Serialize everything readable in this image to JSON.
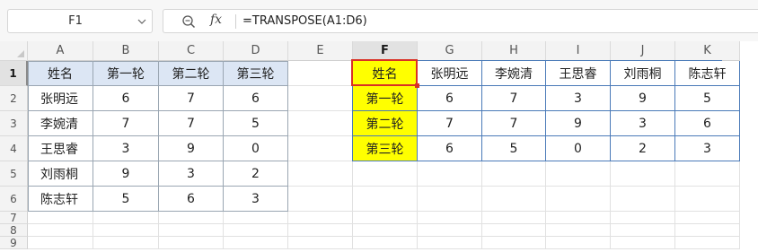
{
  "formula_bar": {
    "name_box": "F1",
    "formula": "=TRANSPOSE(A1:D6)",
    "fx_label": "fx"
  },
  "columns": [
    "A",
    "B",
    "C",
    "D",
    "E",
    "F",
    "G",
    "H",
    "I",
    "J",
    "K"
  ],
  "rows": [
    "1",
    "2",
    "3",
    "4",
    "5",
    "6",
    "7",
    "8",
    "9"
  ],
  "selected": {
    "column": "F",
    "row": "1"
  },
  "colors": {
    "header_blue": "#dce6f4",
    "yellow": "#ffff00",
    "active_border": "#d93025",
    "range_border": "#4a7ab8"
  },
  "cells": {
    "A1": "姓名",
    "B1": "第一轮",
    "C1": "第二轮",
    "D1": "第三轮",
    "A2": "张明远",
    "B2": "6",
    "C2": "7",
    "D2": "6",
    "A3": "李婉清",
    "B3": "7",
    "C3": "7",
    "D3": "5",
    "A4": "王思睿",
    "B4": "3",
    "C4": "9",
    "D4": "0",
    "A5": "刘雨桐",
    "B5": "9",
    "C5": "3",
    "D5": "2",
    "A6": "陈志轩",
    "B6": "5",
    "C6": "6",
    "D6": "3",
    "F1": "姓名",
    "G1": "张明远",
    "H1": "李婉清",
    "I1": "王思睿",
    "J1": "刘雨桐",
    "K1": "陈志轩",
    "F2": "第一轮",
    "G2": "6",
    "H2": "7",
    "I2": "3",
    "J2": "9",
    "K2": "5",
    "F3": "第二轮",
    "G3": "7",
    "H3": "7",
    "I3": "9",
    "J3": "3",
    "K3": "6",
    "F4": "第三轮",
    "G4": "6",
    "H4": "5",
    "I4": "0",
    "J4": "2",
    "K4": "3"
  }
}
